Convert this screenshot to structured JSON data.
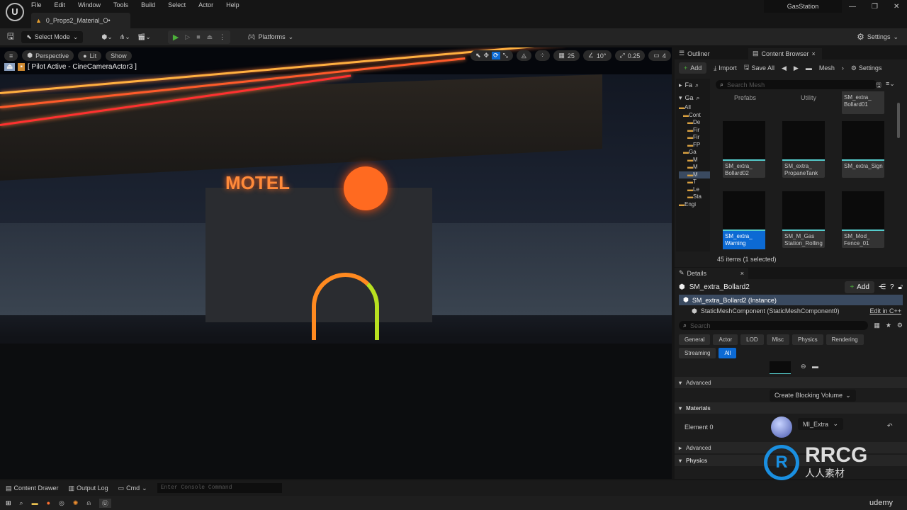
{
  "menu": {
    "items": [
      "File",
      "Edit",
      "Window",
      "Tools",
      "Build",
      "Select",
      "Actor",
      "Help"
    ],
    "doc_tab": "0_Props2_Material_O•",
    "project": "GasStation"
  },
  "toolbar": {
    "select_mode": "Select Mode",
    "platforms": "Platforms",
    "settings": "Settings"
  },
  "viewport": {
    "perspective": "Perspective",
    "lit": "Lit",
    "show": "Show",
    "pilot": "[ Pilot Active - CineCameraActor3 ]",
    "grid_snap": "25",
    "rot_snap": "10°",
    "scale_snap": "0.25",
    "cam_speed": "4",
    "sign_text": "MOTEL"
  },
  "outliner": {
    "tab": "Outliner"
  },
  "content_browser": {
    "tab": "Content Browser",
    "add": "Add",
    "import": "Import",
    "save_all": "Save All",
    "path": "Mesh",
    "settings": "Settings",
    "search_placeholder": "Search Mesh",
    "tree": {
      "fav": "Fa",
      "game": "Ga",
      "items": [
        "All",
        "Cont",
        "De",
        "Fir",
        "Fir",
        "FP",
        "Ga",
        "M",
        "M",
        "M",
        "T",
        "Le",
        "Sta",
        "Engi"
      ]
    },
    "folders": [
      "Prefabs",
      "Utility"
    ],
    "assets": [
      "SM_extra_ Bollard01",
      "SM_extra_ Bollard02",
      "SM_extra_ PropaneTank",
      "SM_extra_Sign",
      "SM_extra_ Warning",
      "SM_M_Gas Station_Rolling",
      "SM_Mod_ Fence_01"
    ],
    "status": "45 items (1 selected)"
  },
  "details": {
    "tab": "Details",
    "actor": "SM_extra_Bollard2",
    "add": "Add",
    "instance": "SM_extra_Bollard2 (Instance)",
    "component": "StaticMeshComponent (StaticMeshComponent0)",
    "edit_cpp": "Edit in C++",
    "search_placeholder": "Search",
    "filters": [
      "General",
      "Actor",
      "LOD",
      "Misc",
      "Physics",
      "Rendering",
      "Streaming",
      "All"
    ],
    "active_filter": "All",
    "advanced": "Advanced",
    "blocking": "Create Blocking Volume",
    "materials": "Materials",
    "element0": "Element 0",
    "material": "MI_Extra",
    "advanced2": "Advanced",
    "physics": "Physics"
  },
  "bottom": {
    "content_drawer": "Content Drawer",
    "output_log": "Output Log",
    "cmd": "Cmd",
    "console_placeholder": "Enter Console Command"
  },
  "watermark": {
    "text": "RRCG",
    "sub": "人人素材",
    "udemy": "udemy"
  },
  "colors": {
    "accent": "#0c6ad4",
    "play": "#4caf3a",
    "neon": "#ff5a2a"
  }
}
